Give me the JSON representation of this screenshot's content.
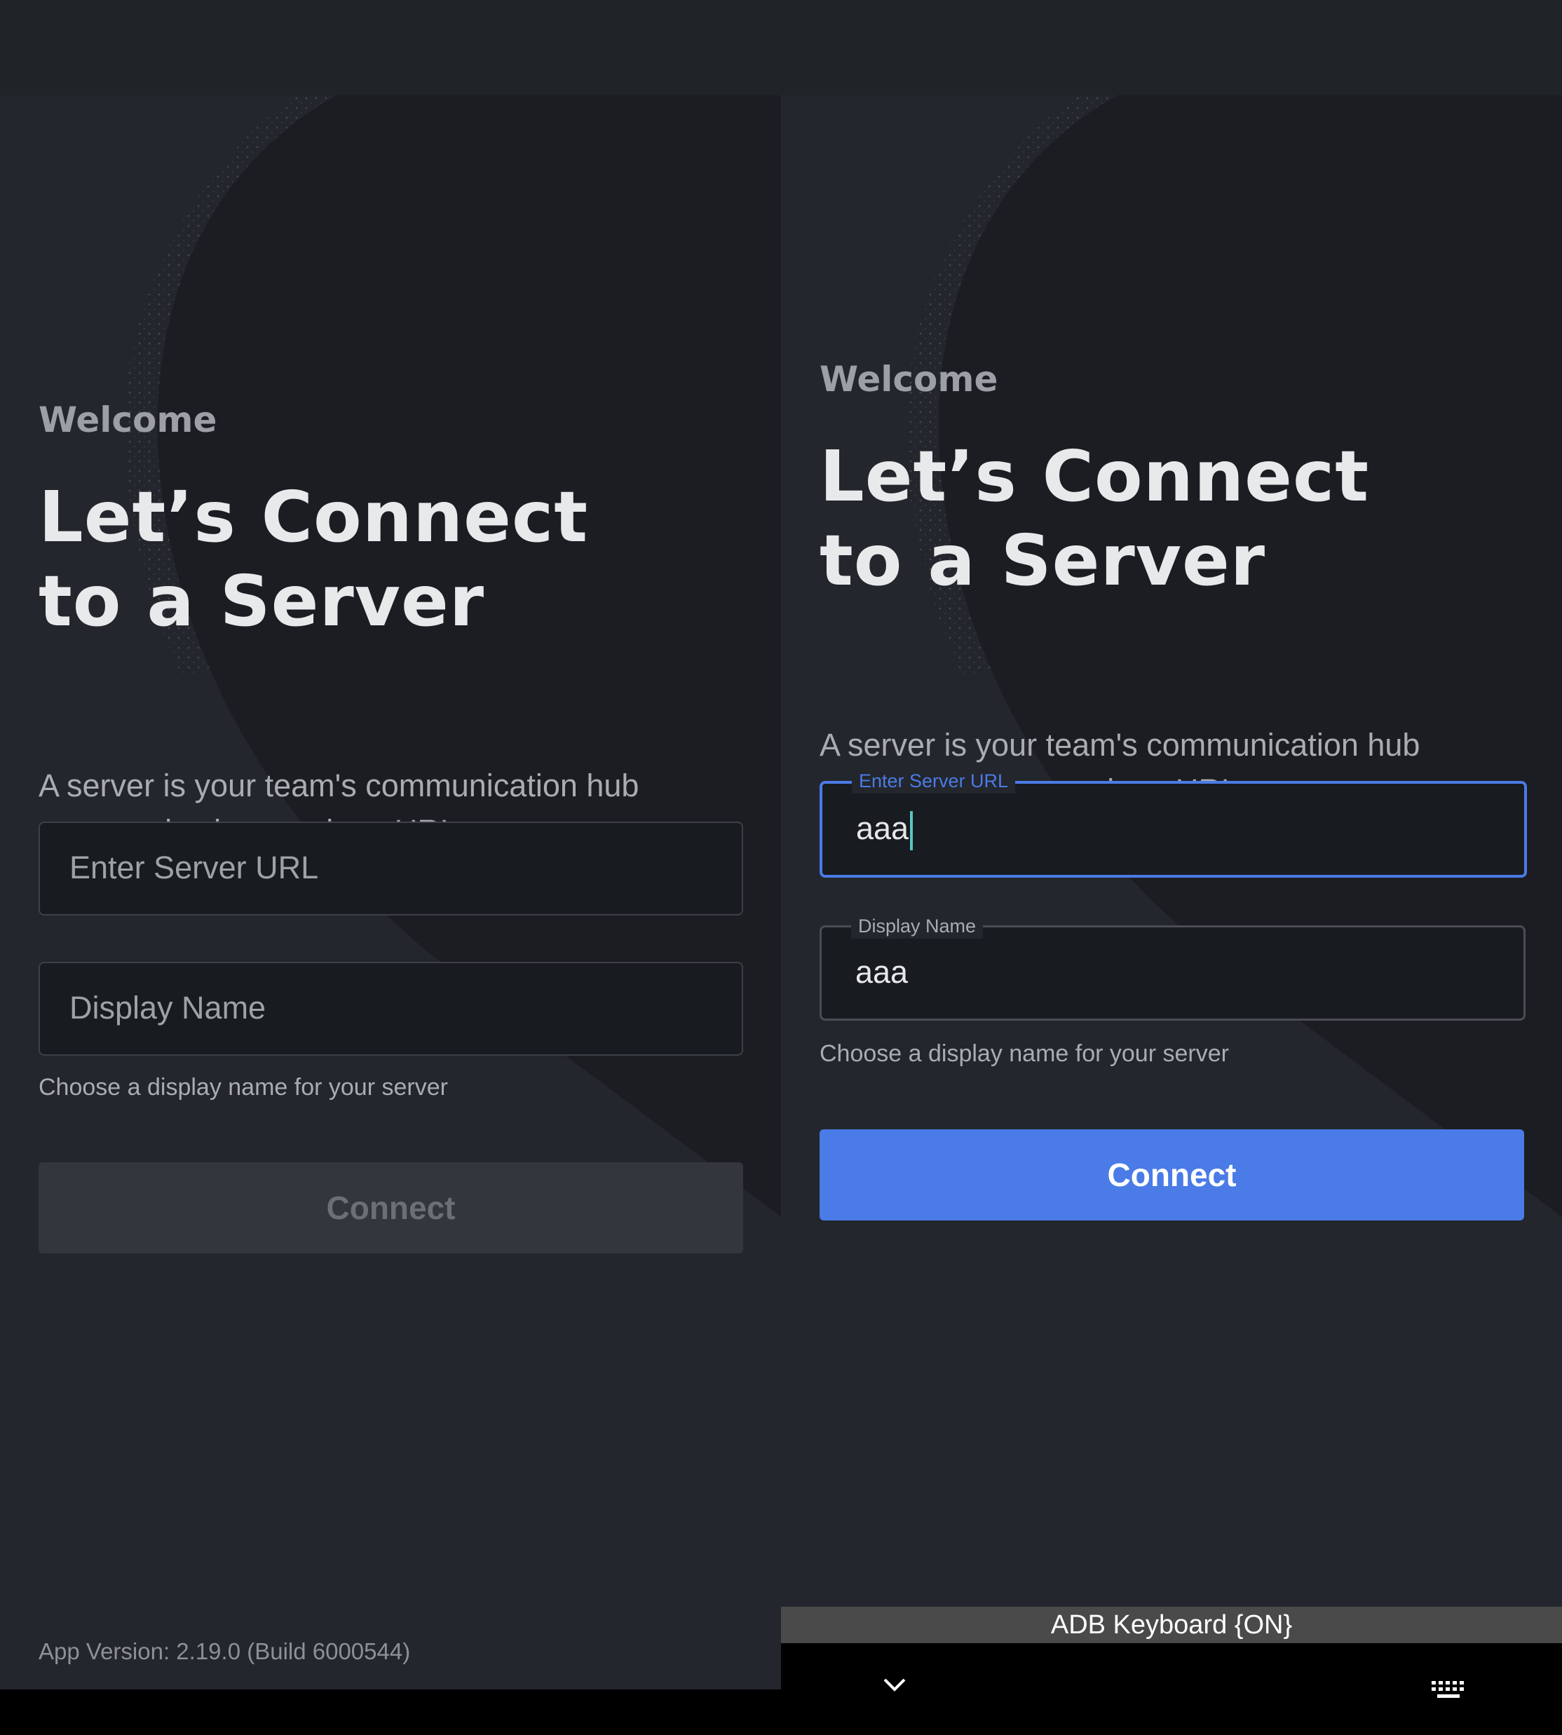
{
  "screens": [
    {
      "welcome": "Welcome",
      "headline_line1": "Let’s Connect",
      "headline_line2": "to a Server",
      "subtitle_line1": "A server is your team's communication hub",
      "subtitle_line2": "accessed using a unique URL",
      "server_url": {
        "placeholder": "Enter Server URL",
        "value": ""
      },
      "display_name": {
        "placeholder": "Display Name",
        "value": ""
      },
      "hint": "Choose a display name for your server",
      "connect_label": "Connect",
      "connect_enabled": false,
      "app_version": "App Version: 2.19.0 (Build 6000544)"
    },
    {
      "welcome": "Welcome",
      "headline_line1": "Let’s Connect",
      "headline_line2": "to a Server",
      "subtitle_line1": "A server is your team's communication hub",
      "subtitle_line2": "accessed using a unique URL",
      "server_url": {
        "label": "Enter Server URL",
        "value": "aaa",
        "focused": true
      },
      "display_name": {
        "label": "Display Name",
        "value": "aaa"
      },
      "hint": "Choose a display name for your server",
      "connect_label": "Connect",
      "connect_enabled": true,
      "keyboard_status": "ADB Keyboard {ON}"
    }
  ],
  "colors": {
    "accent": "#4a7be6",
    "background": "#23262c",
    "input_bg": "#181b20"
  },
  "icons": {
    "nav_collapse": "chevron-down-icon",
    "keyboard_switch": "keyboard-icon"
  }
}
